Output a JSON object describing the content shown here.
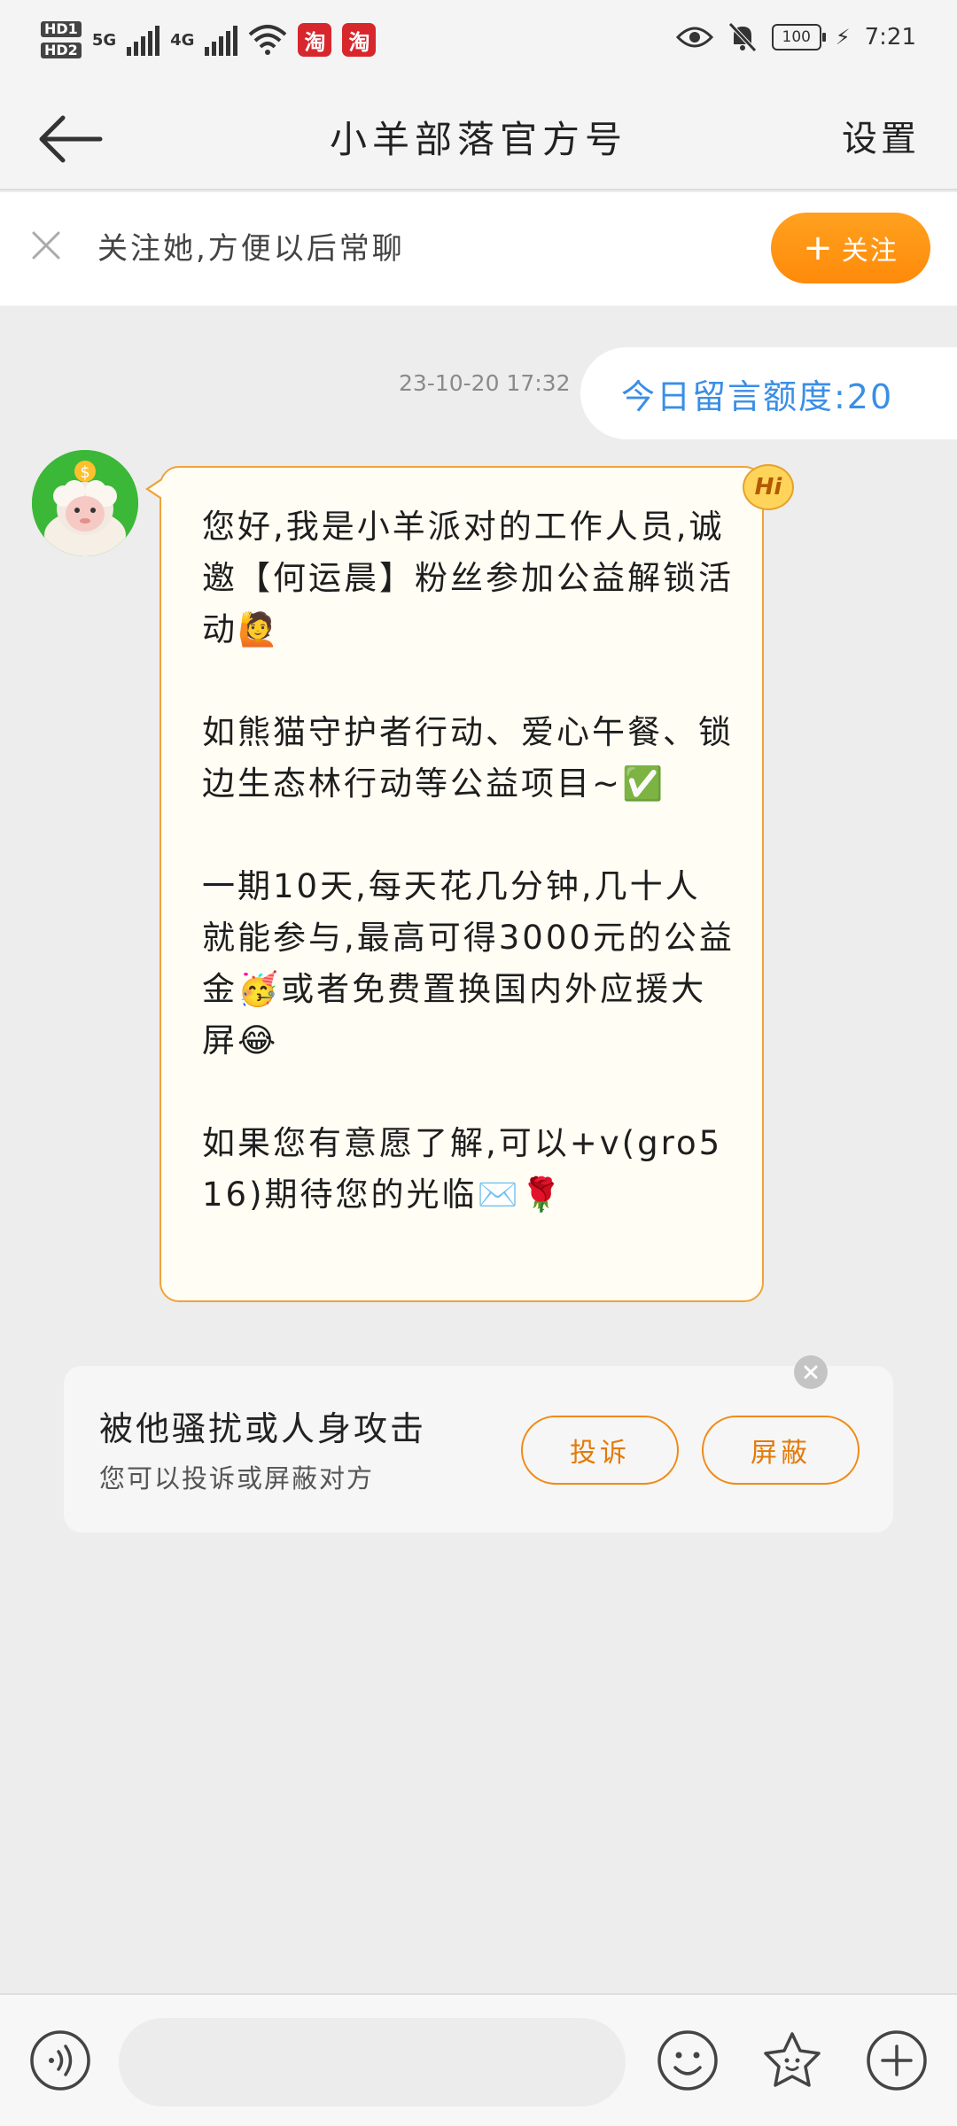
{
  "status_bar": {
    "hd1": "HD1",
    "hd2": "HD2",
    "net1": "5G",
    "net2": "4G",
    "app_icon_char": "淘",
    "battery": "100",
    "time": "7:21"
  },
  "header": {
    "title": "小羊部落官方号",
    "settings_label": "设置"
  },
  "follow_banner": {
    "text": "关注她,方便以后常聊",
    "button_label": "关注"
  },
  "chat": {
    "timestamp": "23-10-20 17:32",
    "quota_message": "今日留言额度:20",
    "hi_badge": "Hi",
    "message_paragraphs": [
      "您好,我是小羊派对的工作人员,诚邀【何运晨】粉丝参加公益解锁活动🙋",
      "如熊猫守护者行动、爱心午餐、锁边生态林行动等公益项目~✅",
      "一期10天,每天花几分钟,几十人就能参与,最高可得3000元的公益金🥳或者免费置换国内外应援大屏😂",
      "如果您有意愿了解,可以+v(gro516)期待您的光临✉️🌹"
    ]
  },
  "harass_card": {
    "title": "被他骚扰或人身攻击",
    "subtitle": "您可以投诉或屏蔽对方",
    "complain_label": "投诉",
    "block_label": "屏蔽"
  },
  "input_bar": {
    "placeholder": ""
  },
  "colors": {
    "accent_orange": "#ff9412",
    "quota_blue": "#3a8ee6",
    "bubble_border": "#f0a23a",
    "background": "#ededed"
  },
  "icons": {
    "back": "arrow-left-icon",
    "close": "close-icon",
    "voice": "voice-icon",
    "emoji": "smiley-icon",
    "sticker": "star-icon",
    "plus": "plus-icon"
  }
}
